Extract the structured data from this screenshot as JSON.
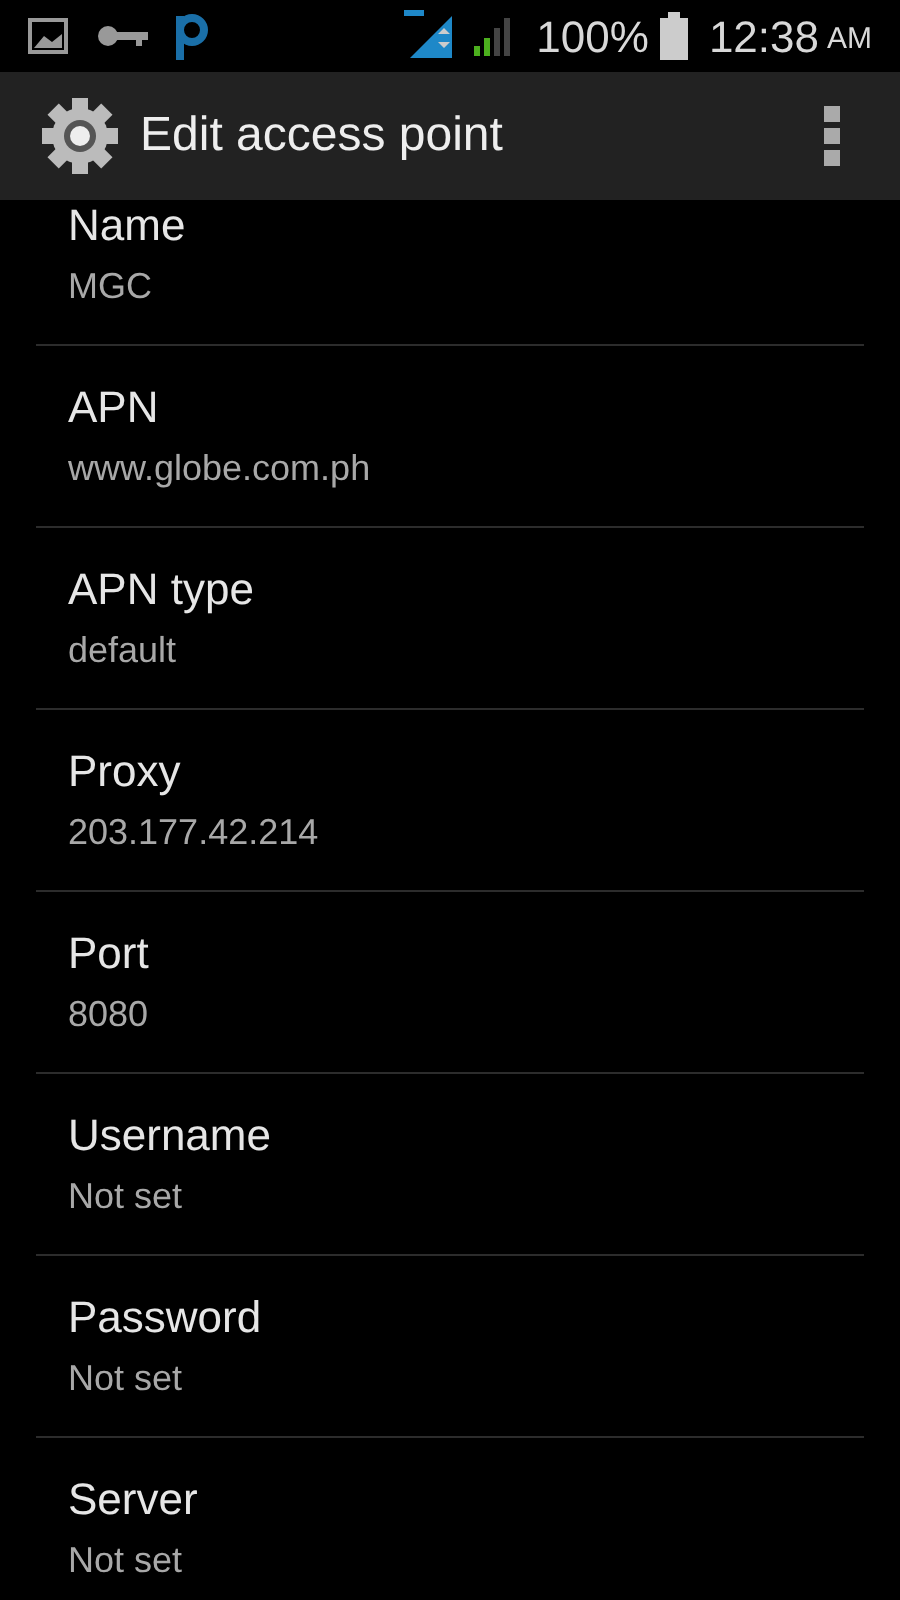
{
  "status_bar": {
    "battery": "100%",
    "time": "12:38",
    "ampm": "AM"
  },
  "action_bar": {
    "title": "Edit access point"
  },
  "settings": [
    {
      "title": "Name",
      "value": "MGC"
    },
    {
      "title": "APN",
      "value": "www.globe.com.ph"
    },
    {
      "title": "APN type",
      "value": "default"
    },
    {
      "title": "Proxy",
      "value": "203.177.42.214"
    },
    {
      "title": "Port",
      "value": "8080"
    },
    {
      "title": "Username",
      "value": "Not set"
    },
    {
      "title": "Password",
      "value": "Not set"
    },
    {
      "title": "Server",
      "value": "Not set"
    }
  ]
}
